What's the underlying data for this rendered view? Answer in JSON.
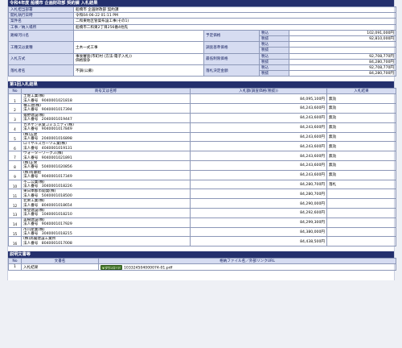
{
  "title": "令和4年度 船橋市 企画財政部 契約課 入札結果",
  "info": {
    "dept_label": "入札担当部署",
    "dept": "船橋市 企画財政部 契約課",
    "date_label": "開札執行日時",
    "date": "令和04-06-22 01:11 PM",
    "case_label": "案件名",
    "case": "二和東地区管渠布設工事(その1)",
    "place_label": "工事／納入場所",
    "place": "船橋市二和東2丁目256番4他先",
    "route_label": "路線河川名",
    "route": "",
    "kind_label": "工種又は業種",
    "kind": "土木一式工事",
    "method_label": "入札方式",
    "method_line1": "事後審査(市町村 (方法:電子入札))",
    "method_line2": "価格競争",
    "failed_label": "落札者名",
    "failed": "不調(公募)",
    "planned_label": "予定価格",
    "survey_label": "調査基準価格",
    "min_label": "最低制限価格",
    "decided_label": "落札決定金額",
    "tax_in": "税込",
    "tax_out": "税抜",
    "planned_in": "102,091,000円",
    "planned_out": "92,810,000円",
    "survey_in": "",
    "survey_out": "",
    "min_in": "92,708,770円",
    "min_out": "84,280,700円",
    "decided_in": "92,708,770円",
    "decided_out": "84,280,700円"
  },
  "round": {
    "title": "第1回入札結果",
    "headers": [
      "No",
      "商号又は名称",
      "入札額(調査価格(税抜))",
      "入札結果"
    ],
    "corp_label": "法人番号",
    "rows": [
      {
        "no": "1",
        "name": "土佐工業(株)",
        "corp": "9040001021818",
        "amount": "84,095,100円",
        "result": "無効"
      },
      {
        "no": "2",
        "name": "種工建(株)",
        "corp": "9040001017394",
        "amount": "84,243,600円",
        "result": "無効"
      },
      {
        "no": "3",
        "name": "猿野建設(株)",
        "corp": "2040001019447",
        "amount": "84,243,600円",
        "result": "無効"
      },
      {
        "no": "4",
        "name": "カネケン京葉コミュニティ(株)",
        "corp": "9040001017849",
        "amount": "84,243,600円",
        "result": "無効"
      },
      {
        "no": "5",
        "name": "(株)五建",
        "corp": "2040001016898",
        "amount": "84,243,600円",
        "result": "無効"
      },
      {
        "no": "6",
        "name": "ロイヤルズガーツ工業(株)",
        "corp": "4040001019131",
        "amount": "84,243,600円",
        "result": "無効"
      },
      {
        "no": "7",
        "name": "ウォーターワークス(株)",
        "corp": "9040001021891",
        "amount": "84,243,600円",
        "result": "無効"
      },
      {
        "no": "8",
        "name": "(株)正栄",
        "corp": "5040001020856",
        "amount": "84,243,600円",
        "result": "無効"
      },
      {
        "no": "9",
        "name": "(株)有藤組",
        "corp": "9040001017349",
        "amount": "84,243,600円",
        "result": "無効"
      },
      {
        "no": "10",
        "name": "不二公業(株)",
        "corp": "3040001018226",
        "amount": "84,280,700円",
        "result": "落札"
      },
      {
        "no": "11",
        "name": "東日本都市開発(株)",
        "corp": "5040001018500",
        "amount": "84,280,700円",
        "result": ""
      },
      {
        "no": "12",
        "name": "北栄工業(株)",
        "corp": "8040001018654",
        "amount": "84,290,000円",
        "result": ""
      },
      {
        "no": "13",
        "name": "栄登建設(株)",
        "corp": "1040001018210",
        "amount": "84,292,600円",
        "result": ""
      },
      {
        "no": "14",
        "name": "美樹建設(株)",
        "corp": "9040001017929",
        "amount": "84,299,300円",
        "result": ""
      },
      {
        "no": "15",
        "name": "市川産業(株)",
        "corp": "3040001018215",
        "amount": "84,380,000円",
        "result": ""
      },
      {
        "no": "16",
        "name": "(株)高閣建設工業所",
        "corp": "8040001017008",
        "amount": "84,438,500円",
        "result": ""
      }
    ]
  },
  "docs": {
    "title": "説明文書等",
    "headers": [
      "No",
      "文書名",
      "格納ファイル名／外部リンクURL"
    ],
    "rows": [
      {
        "no": "1",
        "name": "入札結果",
        "button": "ダウンロード",
        "file": "103324504000074-01.pdf"
      }
    ]
  }
}
